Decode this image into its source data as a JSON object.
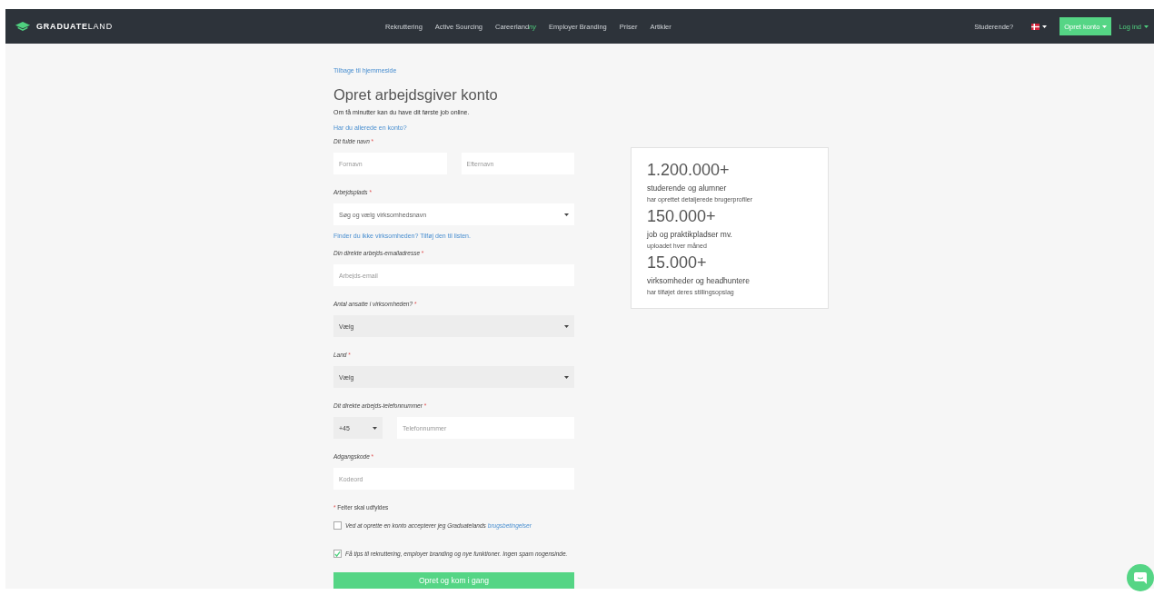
{
  "navbar": {
    "brand": {
      "bold": "GRADUATE",
      "light": "LAND"
    },
    "links": [
      {
        "label": "Rekruttering"
      },
      {
        "label": "Active Sourcing"
      },
      {
        "label": "Careerland",
        "badge": "ny"
      },
      {
        "label": "Employer Branding"
      },
      {
        "label": "Priser"
      },
      {
        "label": "Artikler"
      }
    ],
    "students_link": "Studerende?",
    "signup_button": "Opret konto",
    "login_link": "Log ind"
  },
  "form": {
    "back_link": "Tilbage til hjemmeside",
    "title": "Opret arbejdsgiver konto",
    "intro": "Om få minutter kan du have dit første job online.",
    "login_link": "Har du allerede en konto?",
    "fields": [
      {
        "kind": "name",
        "label": "Dit fulde navn",
        "mark": "*",
        "inputs": [
          {
            "placeholder": "Fornavn"
          },
          {
            "placeholder": "Efternavn"
          }
        ]
      },
      {
        "kind": "search_select",
        "label": "Arbejdsplads",
        "mark": "*",
        "placeholder": "Søg og vælg virksomhedsnavn",
        "help_link": "Finder du ikke virksomheden? Tilføj den til listen."
      },
      {
        "kind": "text",
        "label": "Din direkte arbejds-emailadresse",
        "mark": "*",
        "placeholder": "Arbejds-email"
      },
      {
        "kind": "select",
        "label": "Antal ansatte i virksomheden?",
        "mark": "*",
        "value": "Vælg"
      },
      {
        "kind": "select",
        "label": "Land",
        "mark": "*",
        "value": "Vælg"
      },
      {
        "kind": "phone",
        "label": "Dit direkte arbejds-telefonnummer",
        "mark": "*",
        "code": "+45",
        "placeholder": "Telefonnummer"
      },
      {
        "kind": "text",
        "label": "Adgangskode",
        "mark": "*",
        "placeholder": "Kodeord"
      }
    ],
    "required_note": {
      "mark": "*",
      "text": "Felter skal udfyldes"
    },
    "checkboxes": [
      {
        "checked": false,
        "text": "Ved at oprette en konto accepterer jeg Graduatelands",
        "link": "brugsbetingelser"
      },
      {
        "checked": true,
        "text": "Få tips til rekruttering, employer branding og nye funktioner. Ingen spam nogensinde."
      }
    ],
    "submit_button": "Opret og kom i gang"
  },
  "stats": [
    {
      "number": "1.200.000+",
      "title": "studerende og alumner",
      "caption": "har oprettet detaljerede brugerprofiler"
    },
    {
      "number": "150.000+",
      "title": "job og praktikpladser mv.",
      "caption": "uploadet hver måned"
    },
    {
      "number": "15.000+",
      "title": "virksomheder og headhuntere",
      "caption": "har tilføjet deres stillingsopslag"
    }
  ]
}
